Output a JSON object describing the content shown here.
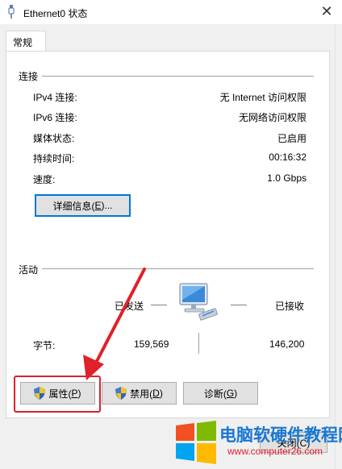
{
  "window": {
    "title": "Ethernet0 状态",
    "close_glyph": "✕"
  },
  "tabs": [
    {
      "label": "常规",
      "selected": true
    }
  ],
  "connection": {
    "group_label": "连接",
    "rows": [
      {
        "label": "IPv4 连接:",
        "value": "无 Internet 访问权限"
      },
      {
        "label": "IPv6 连接:",
        "value": "无网络访问权限"
      },
      {
        "label": "媒体状态:",
        "value": "已启用"
      },
      {
        "label": "持续时间:",
        "value": "00:16:32"
      },
      {
        "label": "速度:",
        "value": "1.0 Gbps"
      }
    ],
    "details_button": {
      "text": "详细信息(",
      "accel": "E",
      "suffix": ")..."
    }
  },
  "activity": {
    "group_label": "活动",
    "sent_label": "已发送",
    "received_label": "已接收",
    "bytes_label": "字节:",
    "bytes_sent": "159,569",
    "bytes_received": "146,200",
    "network_icon": "network-computer-icon"
  },
  "buttons": {
    "properties": {
      "text": "属性(",
      "accel": "P",
      "suffix": ")",
      "icon": "uac-shield-icon"
    },
    "disable": {
      "text": "禁用(",
      "accel": "D",
      "suffix": ")",
      "icon": "uac-shield-icon"
    },
    "diagnose": {
      "text": "诊断(",
      "accel": "G",
      "suffix": ")"
    },
    "close": {
      "label": "关闭(C)"
    }
  },
  "annotation": {
    "arrow_color": "#e0202a",
    "box_color": "#e0202a"
  },
  "watermark": {
    "title": "电脑软硬件教程网",
    "url": "www.computer26.com",
    "logo": "windows-logo-icon",
    "colors": {
      "red": "#f25022",
      "green": "#7fba00",
      "blue": "#00a4ef",
      "yellow": "#ffb900",
      "title": "#1977d2",
      "url": "#e0202a"
    }
  }
}
